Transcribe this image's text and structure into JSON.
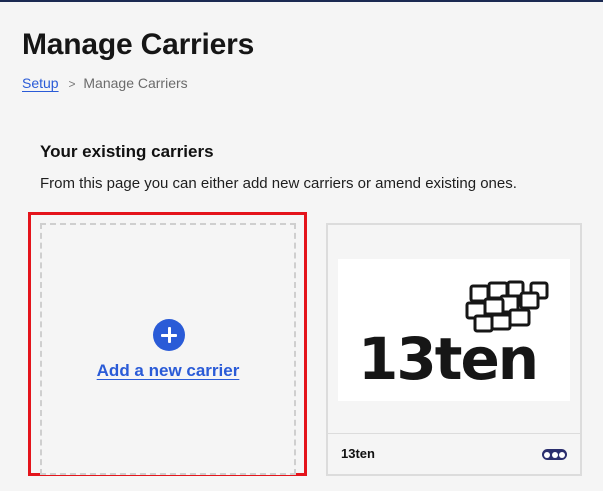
{
  "page": {
    "title": "Manage Carriers"
  },
  "breadcrumb": {
    "items": [
      "Setup",
      "Manage Carriers"
    ],
    "separator": ">"
  },
  "section": {
    "heading": "Your existing carriers",
    "description": "From this page you can either add new carriers or amend existing ones."
  },
  "add_card": {
    "label": "Add a new carrier",
    "icon": "plus-circle-icon"
  },
  "carriers": [
    {
      "name": "13ten",
      "logo_text": "13ten",
      "menu_icon": "more-options-icon"
    }
  ],
  "colors": {
    "accent": "#2a5bd7",
    "highlight": "#e4141b",
    "menu_button": "#2b2f6e",
    "background": "#f5f5f5"
  }
}
